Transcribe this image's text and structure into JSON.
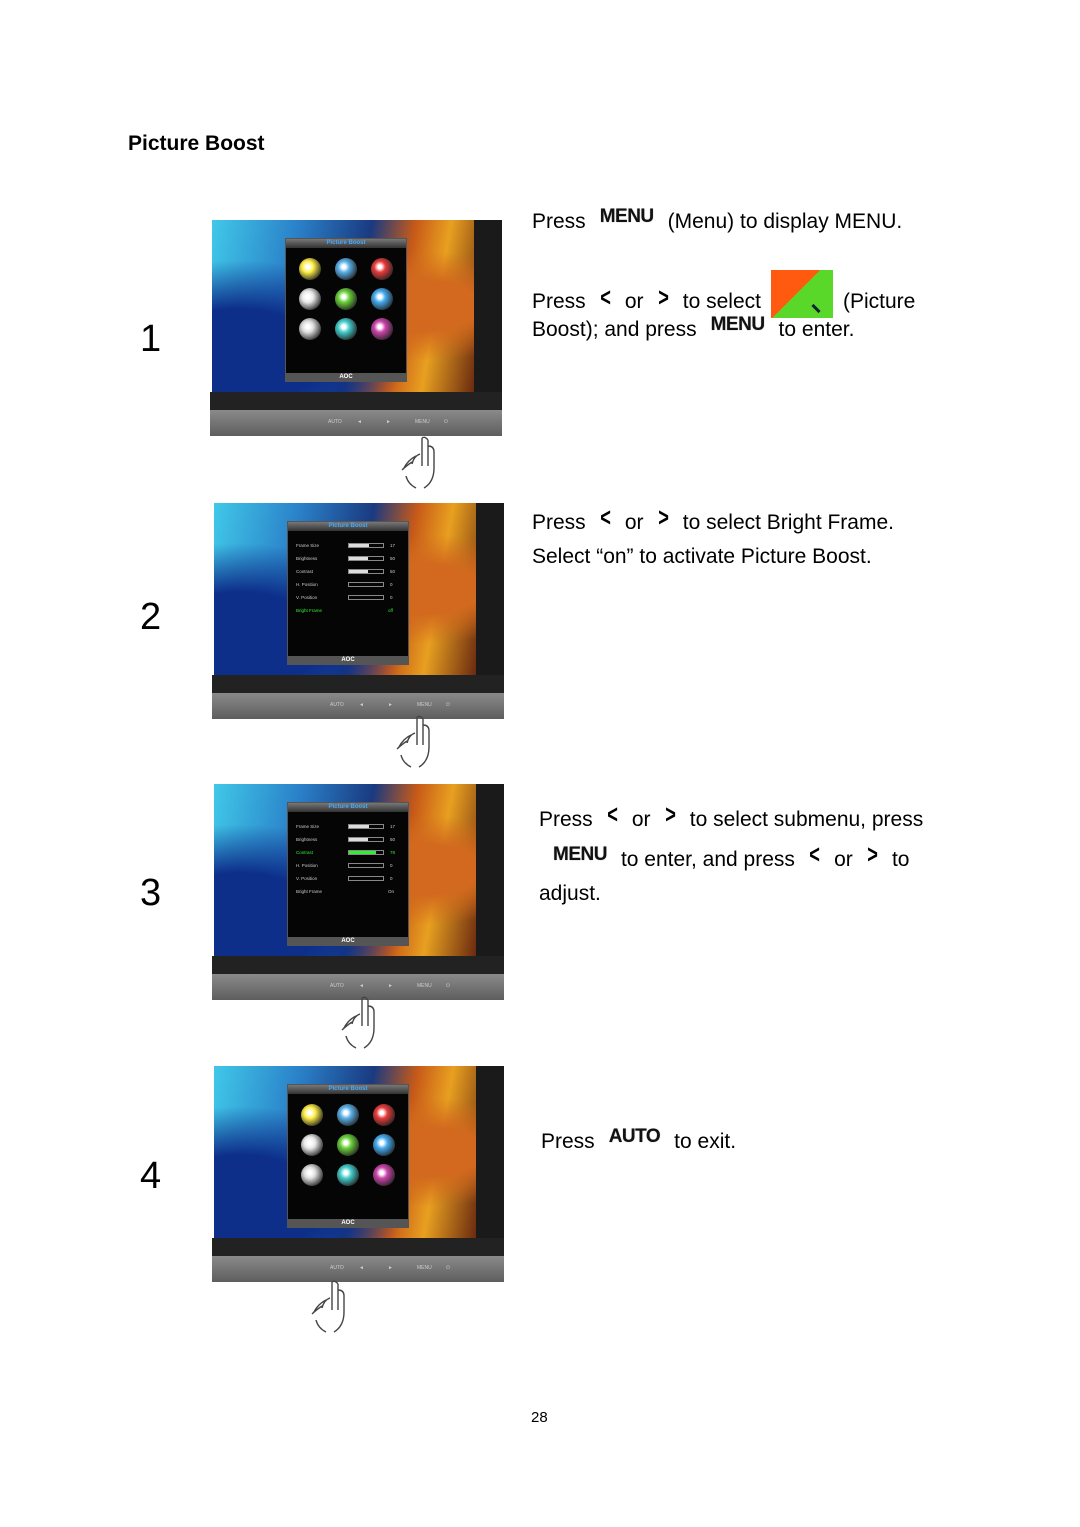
{
  "title": "Picture Boost",
  "page_number": "28",
  "osd": {
    "title": "Picture Boost",
    "logo": "AOC",
    "bezel_labels": [
      "AUTO",
      "◄",
      "►",
      "MENU",
      "⏻"
    ],
    "main_icons": [
      "brightness-icon",
      "image-setup-icon",
      "color-setup-icon",
      "picture-boost-icon-left",
      "picture-boost-icon",
      "osd-setup-icon",
      "extra-icon",
      "reset-icon",
      "exit-icon"
    ],
    "icon_colors": [
      "#ffee44",
      "#5ab0e8",
      "#e83a3a",
      "#e8e8e8",
      "#6ad03a",
      "#44aaf0",
      "#dddddd",
      "#44cccc",
      "#cc44aa"
    ],
    "submenu": [
      {
        "label": "Frame Size",
        "value": "17",
        "fill": 0.6
      },
      {
        "label": "Brightness",
        "value": "50",
        "fill": 0.55
      },
      {
        "label": "Contrast",
        "value": "50",
        "fill": 0.55
      },
      {
        "label": "H. Position",
        "value": "0",
        "fill": 0
      },
      {
        "label": "V. Position",
        "value": "0",
        "fill": 0
      },
      {
        "label": "Bright Frame",
        "value": "off",
        "fill": null
      }
    ],
    "submenu_step3": [
      {
        "label": "Frame Size",
        "value": "17",
        "fill": 0.6
      },
      {
        "label": "Brightness",
        "value": "50",
        "fill": 0.55
      },
      {
        "label": "Contrast",
        "value": "78",
        "fill": 0.78
      },
      {
        "label": "H. Position",
        "value": "0",
        "fill": 0
      },
      {
        "label": "V. Position",
        "value": "0",
        "fill": 0
      },
      {
        "label": "Bright Frame",
        "value": "On",
        "fill": null
      }
    ],
    "highlight_color": "#33ee33"
  },
  "steps": [
    {
      "number": "1",
      "menu": "grid",
      "lines": [
        [
          {
            "t": "Press"
          },
          {
            "key": "MENU"
          },
          {
            "t": "(Menu) to display MENU."
          }
        ],
        [
          {
            "t": "Press"
          },
          {
            "icon": "chevron-left"
          },
          {
            "t": "or"
          },
          {
            "icon": "chevron-right"
          },
          {
            "t": "to select"
          },
          {
            "icon": "picture-boost"
          },
          {
            "t": "(Picture"
          }
        ],
        [
          {
            "t": "Boost); and press"
          },
          {
            "key": "MENU"
          },
          {
            "t": "to enter."
          }
        ]
      ]
    },
    {
      "number": "2",
      "menu": "list",
      "lines": [
        [
          {
            "t": "Press"
          },
          {
            "icon": "chevron-left"
          },
          {
            "t": "or"
          },
          {
            "icon": "chevron-right"
          },
          {
            "t": "to select Bright Frame."
          }
        ],
        [
          {
            "t": "Select “on” to activate Picture Boost."
          }
        ]
      ]
    },
    {
      "number": "3",
      "menu": "list3",
      "lines": [
        [
          {
            "t": "Press"
          },
          {
            "icon": "chevron-left"
          },
          {
            "t": "or"
          },
          {
            "icon": "chevron-right"
          },
          {
            "t": "to select submenu, press"
          }
        ],
        [
          {
            "key": "MENU"
          },
          {
            "t": "to enter, and press"
          },
          {
            "icon": "chevron-left"
          },
          {
            "t": "or"
          },
          {
            "icon": "chevron-right"
          },
          {
            "t": "to"
          }
        ],
        [
          {
            "t": "adjust."
          }
        ]
      ]
    },
    {
      "number": "4",
      "menu": "grid",
      "lines": [
        [
          {
            "t": "Press"
          },
          {
            "key": "AUTO"
          },
          {
            "t": "to exit."
          }
        ]
      ]
    }
  ]
}
